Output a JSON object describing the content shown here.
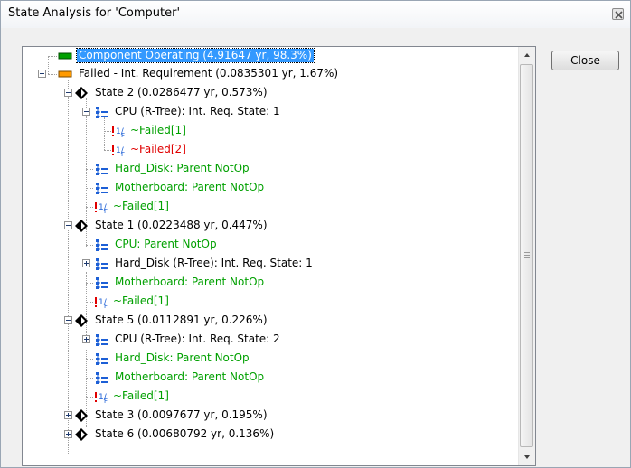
{
  "window": {
    "title": "State Analysis for 'Computer'"
  },
  "buttons": {
    "close_label": "Close"
  },
  "tree": {
    "nodes": [
      {
        "label": "Component Operating (4.91647 yr, 98.3%)",
        "icon": "green-status-bar-icon",
        "style": "selected"
      },
      {
        "label": "Failed - Int. Requirement (0.0835301 yr, 1.67%)",
        "icon": "orange-status-bar-icon",
        "expander": "expanded"
      },
      {
        "label": "State 2 (0.0286477 yr, 0.573%)",
        "icon": "diamond-state-icon",
        "expander": "expanded"
      },
      {
        "label": "CPU (R-Tree): Int. Req. State: 1",
        "icon": "rtree-icon",
        "expander": "expanded"
      },
      {
        "label": "~Failed[1]",
        "icon": "failure-mode-icon",
        "color": "green"
      },
      {
        "label": "~Failed[2]",
        "icon": "failure-mode-icon",
        "color": "red"
      },
      {
        "label": "Hard_Disk: Parent NotOp",
        "icon": "rtree-icon",
        "color": "green"
      },
      {
        "label": "Motherboard: Parent NotOp",
        "icon": "rtree-icon",
        "color": "green"
      },
      {
        "label": "~Failed[1]",
        "icon": "failure-mode-icon",
        "color": "green"
      },
      {
        "label": "State 1 (0.0223488 yr, 0.447%)",
        "icon": "diamond-state-icon",
        "expander": "expanded"
      },
      {
        "label": "CPU: Parent NotOp",
        "icon": "rtree-icon",
        "color": "green"
      },
      {
        "label": "Hard_Disk (R-Tree): Int. Req. State: 1",
        "icon": "rtree-icon",
        "expander": "collapsed"
      },
      {
        "label": "Motherboard: Parent NotOp",
        "icon": "rtree-icon",
        "color": "green"
      },
      {
        "label": "~Failed[1]",
        "icon": "failure-mode-icon",
        "color": "green"
      },
      {
        "label": "State 5 (0.0112891 yr, 0.226%)",
        "icon": "diamond-state-icon",
        "expander": "expanded"
      },
      {
        "label": "CPU (R-Tree): Int. Req. State: 2",
        "icon": "rtree-icon",
        "expander": "collapsed"
      },
      {
        "label": "Hard_Disk: Parent NotOp",
        "icon": "rtree-icon",
        "color": "green"
      },
      {
        "label": "Motherboard: Parent NotOp",
        "icon": "rtree-icon",
        "color": "green"
      },
      {
        "label": "~Failed[1]",
        "icon": "failure-mode-icon",
        "color": "green"
      },
      {
        "label": "State 3 (0.0097677 yr, 0.195%)",
        "icon": "diamond-state-icon",
        "expander": "collapsed"
      },
      {
        "label": "State 6 (0.00680792 yr, 0.136%)",
        "icon": "diamond-state-icon",
        "expander": "collapsed"
      }
    ]
  },
  "colors": {
    "green_text": "#00a000",
    "red_text": "#e00000",
    "selection": "#3399ff"
  }
}
